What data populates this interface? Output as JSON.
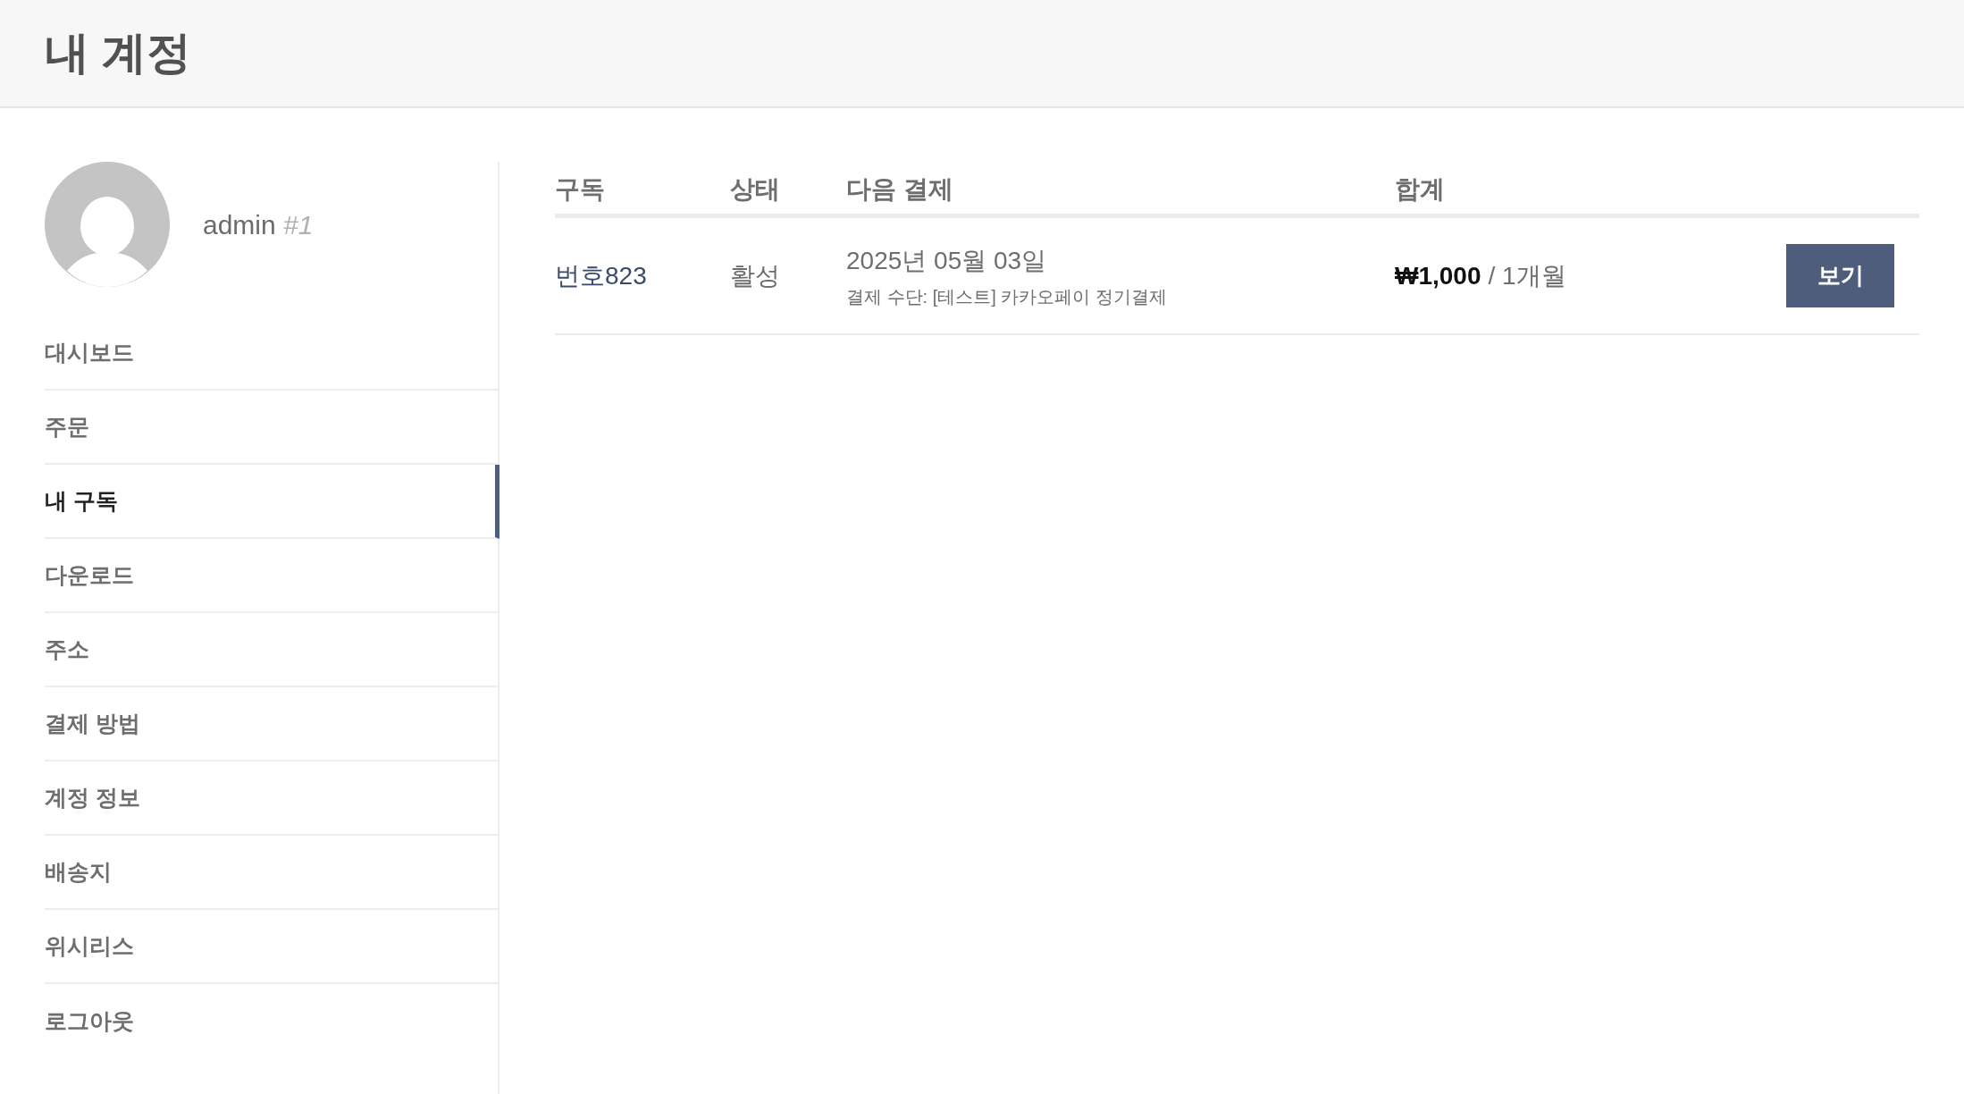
{
  "page_title": "내 계정",
  "user": {
    "name": "admin",
    "id": "#1"
  },
  "nav": [
    {
      "label": "대시보드",
      "selected": false
    },
    {
      "label": "주문",
      "selected": false
    },
    {
      "label": "내 구독",
      "selected": true
    },
    {
      "label": "다운로드",
      "selected": false
    },
    {
      "label": "주소",
      "selected": false
    },
    {
      "label": "결제 방법",
      "selected": false
    },
    {
      "label": "계정 정보",
      "selected": false
    },
    {
      "label": "배송지",
      "selected": false
    },
    {
      "label": "위시리스",
      "selected": false
    },
    {
      "label": "로그아웃",
      "selected": false
    }
  ],
  "table": {
    "columns": [
      "구독",
      "상태",
      "다음 결제",
      "합계"
    ],
    "rows": [
      {
        "subscription": "번호823",
        "status": "활성",
        "next_payment": "2025년 05월 03일",
        "payment_method": "결제 수단: [테스트] 카카오페이 정기결제",
        "amount": "₩1,000",
        "period": "/ 1개월",
        "action": "보기"
      }
    ]
  }
}
